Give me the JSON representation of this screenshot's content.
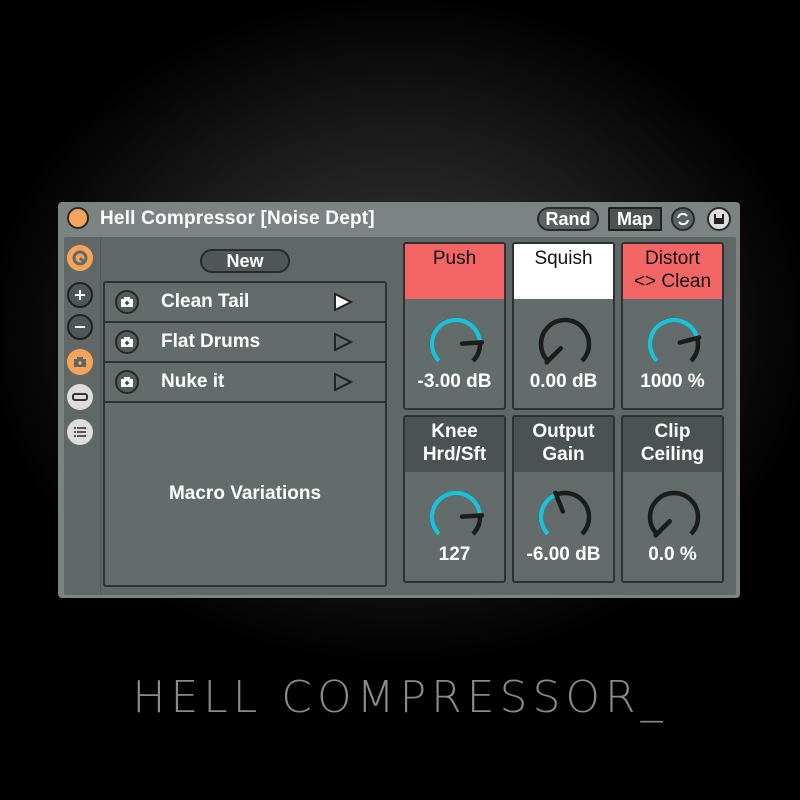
{
  "device": {
    "title": "Hell Compressor [Noise Dept]",
    "buttons": {
      "rand": "Rand",
      "map": "Map"
    },
    "icons": {
      "power": "power-icon",
      "sync": "sync-icon",
      "save": "save-icon"
    }
  },
  "sidebar": {
    "icons": [
      "macro-dial-icon",
      "plus-icon",
      "minus-icon",
      "snapshot-icon",
      "collapse-icon",
      "list-icon"
    ]
  },
  "variations": {
    "new_label": "New",
    "items": [
      {
        "label": "Clean Tail",
        "active": true
      },
      {
        "label": "Flat Drums",
        "active": false
      },
      {
        "label": "Nuke it",
        "active": false
      }
    ],
    "section_label": "Macro Variations"
  },
  "macros": [
    {
      "label": "Push",
      "value": "-3.00 dB",
      "header": "red",
      "fraction": 0.82,
      "accent": "#1cc1d6"
    },
    {
      "label": "Squish",
      "value": "0.00 dB",
      "header": "white",
      "fraction": 0.0,
      "accent": "#1cc1d6"
    },
    {
      "label": "Distort\n<> Clean",
      "value": "1000 %",
      "header": "red",
      "fraction": 0.78,
      "accent": "#1cc1d6"
    },
    {
      "label": "Knee\nHrd/Sft",
      "value": "127",
      "header": "dark",
      "fraction": 0.82,
      "accent": "#1cc1d6"
    },
    {
      "label": "Output\nGain",
      "value": "-6.00 dB",
      "header": "dark",
      "fraction": 0.42,
      "accent": "#1cc1d6"
    },
    {
      "label": "Clip\nCeiling",
      "value": "0.0 %",
      "header": "dark",
      "fraction": 0.0,
      "accent": "#1cc1d6"
    }
  ],
  "brand": "HELL COMPRESSOR_"
}
